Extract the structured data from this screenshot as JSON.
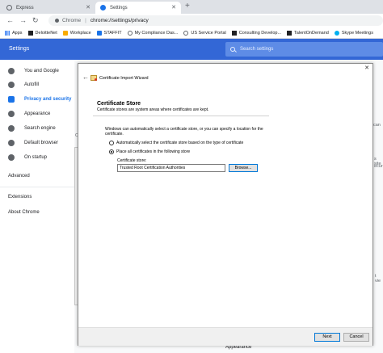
{
  "tabs": [
    {
      "label": "Express",
      "active": false
    },
    {
      "label": "Settings",
      "active": true
    }
  ],
  "toolbar": {
    "back_icon": "back-arrow-icon",
    "forward_icon": "forward-arrow-icon",
    "reload_icon": "reload-icon",
    "site_label": "Chrome",
    "url": "chrome://settings/privacy"
  },
  "bookmarks": [
    {
      "label": "Apps",
      "icon": "grid"
    },
    {
      "label": "DeloitteNet",
      "icon": "dark"
    },
    {
      "label": "Workplace",
      "icon": "folder"
    },
    {
      "label": "STAFFIT",
      "icon": "blue"
    },
    {
      "label": "My Compliance Das...",
      "icon": "ring"
    },
    {
      "label": "US Service Portal",
      "icon": "ring"
    },
    {
      "label": "Consulting Develop...",
      "icon": "dark"
    },
    {
      "label": "TalentOnDemand",
      "icon": "dark"
    },
    {
      "label": "Skype Meetings",
      "icon": "skype"
    }
  ],
  "settings": {
    "title": "Settings",
    "search_placeholder": "Search settings"
  },
  "sidebar": {
    "items": [
      {
        "label": "You and Google"
      },
      {
        "label": "Autofill"
      },
      {
        "label": "Privacy and security",
        "active": true
      },
      {
        "label": "Appearance"
      },
      {
        "label": "Search engine"
      },
      {
        "label": "Default browser"
      },
      {
        "label": "On startup"
      }
    ],
    "advanced": "Advanced",
    "extensions": "Extensions",
    "about": "About Chrome"
  },
  "background": {
    "peek_1": "can",
    "peek_2": "s site",
    "peek_3": "ecurit",
    "peek_4": "t vie",
    "peek_left": "Ce",
    "bottom_label": "Appearance"
  },
  "wizard": {
    "title": "Certificate Import Wizard",
    "heading": "Certificate Store",
    "subheading": "Certificate stores are system areas where certificates are kept.",
    "description": "Windows can automatically select a certificate store, or you can specify a location for the certificate.",
    "option_auto": "Automatically select the certificate store based on the type of certificate",
    "option_manual": "Place all certificates in the following store",
    "selected_option": "manual",
    "store_label": "Certificate store:",
    "store_value": "Trusted Root Certification Authorities",
    "browse_label": "Browse...",
    "next_label": "Next",
    "cancel_label": "Cancel"
  }
}
